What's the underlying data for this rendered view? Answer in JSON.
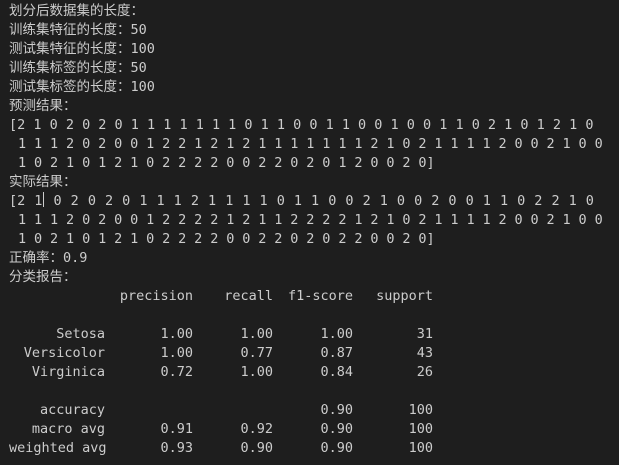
{
  "lines": {
    "split_header": "划分后数据集的长度：",
    "train_feat": "训练集特征的长度：50",
    "test_feat": "测试集特征的长度：100",
    "train_label": "训练集标签的长度：50",
    "test_label": "测试集标签的长度：100",
    "pred_header": "预测结果：",
    "actual_header": "实际结果：",
    "accuracy": "正确率：0.9",
    "report_header": "分类报告："
  },
  "pred": {
    "line1": [
      "[2",
      "1",
      "0",
      "2",
      "0",
      "2",
      "0",
      "1",
      "1",
      "1",
      "1",
      "1",
      "1",
      "1",
      "0",
      "1",
      "1",
      "0",
      "0",
      "1",
      "1",
      "0",
      "0",
      "1",
      "0",
      "0",
      "1",
      "1",
      "0",
      "2",
      "1",
      "0",
      "1",
      "2",
      "1",
      "0"
    ],
    "line2": [
      "1",
      "1",
      "1",
      "2",
      "0",
      "2",
      "0",
      "0",
      "1",
      "2",
      "2",
      "1",
      "2",
      "1",
      "2",
      "1",
      "1",
      "1",
      "1",
      "1",
      "1",
      "1",
      "2",
      "1",
      "0",
      "2",
      "1",
      "1",
      "1",
      "1",
      "2",
      "0",
      "0",
      "2",
      "1",
      "0",
      "0"
    ],
    "line3": [
      "1",
      "0",
      "2",
      "1",
      "0",
      "1",
      "2",
      "1",
      "0",
      "2",
      "2",
      "2",
      "2",
      "0",
      "0",
      "2",
      "2",
      "0",
      "2",
      "0",
      "1",
      "2",
      "0",
      "0",
      "2",
      "0]"
    ]
  },
  "actual": {
    "line1": [
      "[2",
      "1",
      "0",
      "2",
      "0",
      "2",
      "0",
      "1",
      "1",
      "1",
      "2",
      "1",
      "1",
      "1",
      "1",
      "0",
      "1",
      "1",
      "0",
      "0",
      "2",
      "1",
      "0",
      "0",
      "2",
      "0",
      "0",
      "1",
      "1",
      "0",
      "2",
      "2",
      "1",
      "0"
    ],
    "line2": [
      "1",
      "1",
      "1",
      "2",
      "0",
      "2",
      "0",
      "0",
      "1",
      "2",
      "2",
      "2",
      "2",
      "1",
      "2",
      "1",
      "1",
      "2",
      "2",
      "2",
      "2",
      "1",
      "2",
      "1",
      "0",
      "2",
      "1",
      "1",
      "1",
      "1",
      "2",
      "0",
      "0",
      "2",
      "1",
      "0",
      "0"
    ],
    "line3": [
      "1",
      "0",
      "2",
      "1",
      "0",
      "1",
      "2",
      "1",
      "0",
      "2",
      "2",
      "2",
      "2",
      "0",
      "0",
      "2",
      "2",
      "0",
      "2",
      "0",
      "2",
      "2",
      "0",
      "0",
      "2",
      "0]"
    ]
  },
  "report": {
    "headers": [
      "",
      "precision",
      "recall",
      "f1-score",
      "support"
    ],
    "rows": [
      [
        "Setosa",
        "1.00",
        "1.00",
        "1.00",
        "31"
      ],
      [
        "Versicolor",
        "1.00",
        "0.77",
        "0.87",
        "43"
      ],
      [
        "Virginica",
        "0.72",
        "1.00",
        "0.84",
        "26"
      ],
      [
        "",
        "",
        "",
        "",
        ""
      ],
      [
        "accuracy",
        "",
        "",
        "0.90",
        "100"
      ],
      [
        "macro avg",
        "0.91",
        "0.92",
        "0.90",
        "100"
      ],
      [
        "weighted avg",
        "0.93",
        "0.90",
        "0.90",
        "100"
      ]
    ]
  }
}
